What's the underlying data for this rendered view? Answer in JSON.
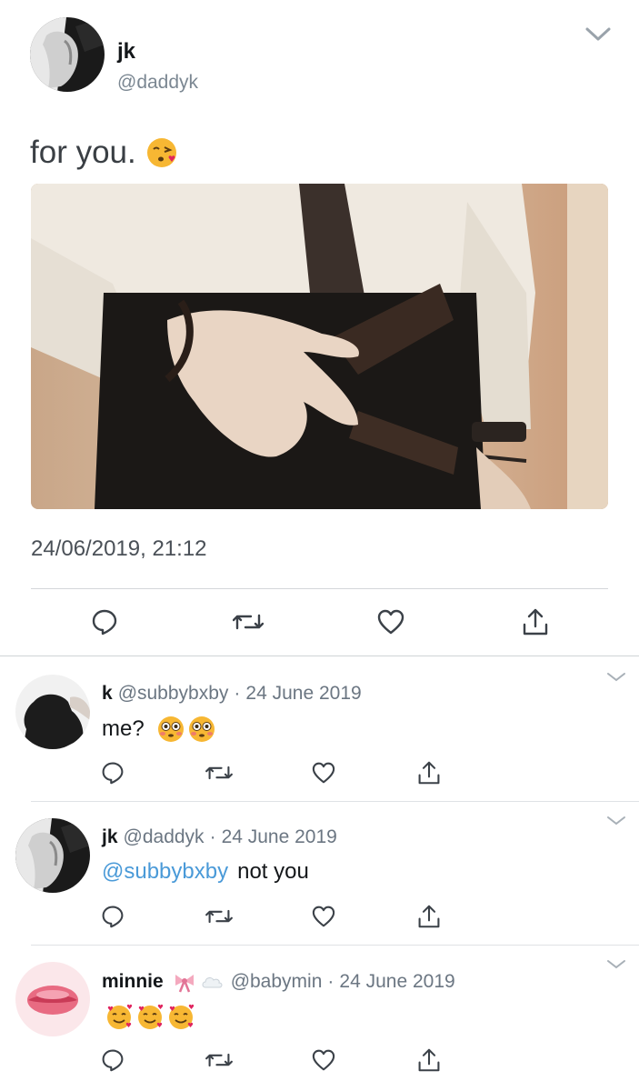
{
  "main_tweet": {
    "author_name": "jk",
    "author_handle": "@daddyk",
    "text": "for you.",
    "text_emoji": "face-blowing-kiss",
    "image": "photo-white-shirt-tie-belt",
    "timestamp": "24/06/2019, 21:12",
    "actions": [
      "reply-icon",
      "retweet-icon",
      "like-icon",
      "share-icon"
    ]
  },
  "replies": [
    {
      "name": "k",
      "handle": "@subbybxby",
      "separator": "·",
      "date": "24 June 2019",
      "mention": "",
      "text": "me?",
      "emojis": [
        "flushed-face",
        "flushed-face"
      ]
    },
    {
      "name": "jk",
      "handle": "@daddyk",
      "separator": "·",
      "date": "24 June 2019",
      "mention": "@subbybxby",
      "text": "not you",
      "emojis": []
    },
    {
      "name": "minnie",
      "name_emojis": [
        "ribbon",
        "cloud"
      ],
      "handle": "@babymin",
      "separator": "·",
      "date": "24 June 2019",
      "mention": "",
      "text": "",
      "emojis": [
        "smiling-face-with-hearts",
        "smiling-face-with-hearts",
        "smiling-face-with-hearts"
      ]
    }
  ],
  "colors": {
    "text": "#14171a",
    "secondary": "#6b7682",
    "mention": "#4a9ad8",
    "divider": "#d4d7da"
  }
}
